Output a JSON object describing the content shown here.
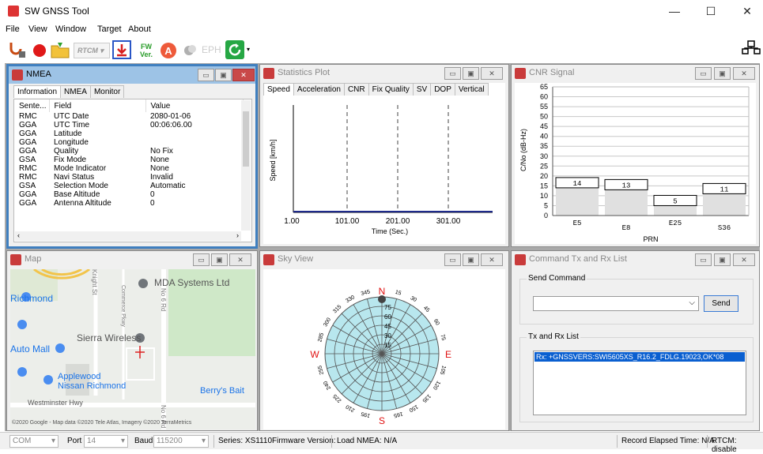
{
  "window": {
    "title": "SW GNSS Tool",
    "minimize": "—",
    "maximize": "☐",
    "close": "✕"
  },
  "menu": [
    "File",
    "View",
    "Window",
    "Target",
    "About"
  ],
  "toolbar": {
    "rtcm_label": "RTCM",
    "fw_label": "FW",
    "ver_label": "Ver.",
    "a_label": "A",
    "eph_label": "EPH"
  },
  "nmea": {
    "title": "NMEA",
    "tabs": [
      "Information",
      "NMEA",
      "Monitor"
    ],
    "columns": [
      "Sente...",
      "Field",
      "Value"
    ],
    "rows": [
      [
        "RMC",
        "UTC Date",
        "2080-01-06"
      ],
      [
        "GGA",
        "UTC Time",
        "00:06:06.00"
      ],
      [
        "GGA",
        "Latitude",
        ""
      ],
      [
        "GGA",
        "Longitude",
        ""
      ],
      [
        "GGA",
        "Quality",
        "No Fix"
      ],
      [
        "GSA",
        "Fix Mode",
        "None"
      ],
      [
        "RMC",
        "Mode Indicator",
        "None"
      ],
      [
        "RMC",
        "Navi Status",
        "Invalid"
      ],
      [
        "GSA",
        "Selection Mode",
        "Automatic"
      ],
      [
        "GGA",
        "Base Altitude",
        "0"
      ],
      [
        "GGA",
        "Antenna Altitude",
        "0"
      ]
    ]
  },
  "stats": {
    "title": "Statistics Plot",
    "tabs": [
      "Speed",
      "Acceleration",
      "CNR",
      "Fix Quality",
      "SV",
      "DOP",
      "Vertical"
    ]
  },
  "chart_data": [
    {
      "type": "line",
      "ylabel": "Speed [km/h]",
      "xlabel": "Time (Sec.)",
      "x_ticks": [
        "1.00",
        "101.00",
        "201.00",
        "301.00"
      ],
      "series": [
        {
          "values": [
            0,
            0,
            0,
            0
          ]
        }
      ]
    },
    {
      "type": "bar",
      "title": "CNR Signal",
      "xlabel": "PRN",
      "ylabel": "C/No (dB-Hz)",
      "ylim": [
        0,
        65
      ],
      "y_ticks": [
        "65",
        "60",
        "55",
        "50",
        "45",
        "40",
        "35",
        "30",
        "25",
        "20",
        "15",
        "10",
        "5",
        "0"
      ],
      "categories": [
        "E5",
        "E8",
        "E25",
        "S36"
      ],
      "values": [
        14,
        13,
        5,
        11
      ]
    }
  ],
  "cnr": {
    "title": "CNR Signal"
  },
  "map": {
    "title": "Map",
    "labels": {
      "mda": "MDA Systems Ltd",
      "richmond": "Richmond",
      "sierra": "Sierra Wireless",
      "automall": "Auto Mall",
      "applewood1": "Applewood",
      "applewood2": "Nissan Richmond",
      "berrys": "Berry's Bait",
      "westminster": "Westminster Hwy",
      "knight": "Knight St",
      "commerce": "Commerce Pkwy",
      "no6": "No 6 Rd",
      "no6b": "No 6 Rd",
      "copyright": "©2020 Google - Map data ©2020 Tele Atlas, Imagery ©2020 TerraMetrics"
    }
  },
  "sky": {
    "title": "Sky View",
    "N": "N",
    "S": "S",
    "E": "E",
    "W": "W",
    "rings": [
      "15",
      "30",
      "45",
      "60",
      "75"
    ],
    "az": [
      "15",
      "30",
      "45",
      "60",
      "75",
      "105",
      "120",
      "135",
      "150",
      "165",
      "195",
      "210",
      "225",
      "240",
      "255",
      "285",
      "300",
      "315",
      "330",
      "345"
    ]
  },
  "cmd": {
    "title": "Command Tx and Rx List",
    "send_group": "Send Command",
    "send_btn": "Send",
    "list_group": "Tx and Rx List",
    "rx_line": "Rx: +GNSSVERS:SWI5605XS_R16.2_FDLG.19023,OK*08"
  },
  "status": {
    "com": "COM",
    "port_label": "Port",
    "port_value": "14",
    "baud_label": "Baud",
    "baud_value": "115200",
    "series": "Series: XS1110",
    "firmware": "Firmware Version:",
    "load": "Load NMEA: N/A",
    "record": "Record Elapsed Time: N/A",
    "rtcm": "RTCM: disable"
  },
  "colors": {
    "accent": "#3f7fbf",
    "plot_line": "#1e2a8a",
    "sky_fill": "#b8e7ee",
    "sky_mark": "#e01010",
    "select": "#0a5fd0"
  }
}
